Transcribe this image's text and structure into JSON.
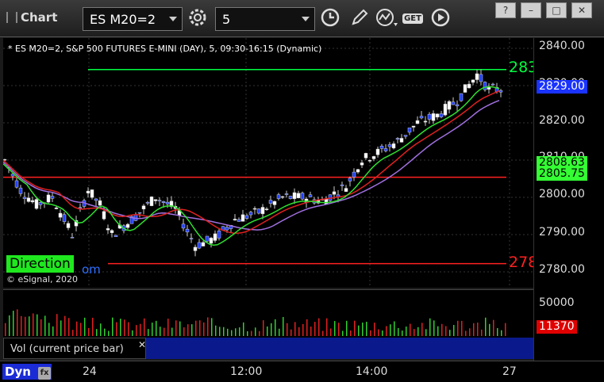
{
  "app": {
    "title": "Chart"
  },
  "toolbar": {
    "symbol": "ES M20=2",
    "interval": "5",
    "icons": [
      "gear-icon",
      "clock-icon",
      "pencil-icon",
      "chart-line-icon",
      "get-icon",
      "play-icon"
    ],
    "get_label": "GET"
  },
  "window_buttons": {
    "help": "?",
    "minimize": "–",
    "restore": "□",
    "close": "✕"
  },
  "chart": {
    "legend": "* ES M20=2, S&P 500 FUTURES E-MINI (DAY), 5, 09:30-16:15 (Dynamic)",
    "copyright": "© eSignal, 2020",
    "direction_label": "Direction",
    "direction_suffix": "om",
    "level_top_label": "283",
    "level_bottom_label": "278"
  },
  "chart_data": {
    "type": "line",
    "price_ticks": [
      "2840.00",
      "2830.00",
      "2820.00",
      "2810.00",
      "2800.00",
      "2790.00",
      "2780.00"
    ],
    "price_tag_last": "2829.00",
    "price_tag_green1": "2808.63",
    "price_tag_green2": "2805.75",
    "vol_ticks": [
      "50000"
    ],
    "vol_tag": "11370",
    "time_ticks": [
      "24",
      "12:00",
      "14:00",
      "27"
    ],
    "levels": [
      2834.3,
      2805.4,
      2782.2
    ]
  },
  "study": {
    "label": "Vol (current price bar)",
    "close": "✕"
  },
  "footer": {
    "dyn": "Dyn",
    "dyn_icon": "fx"
  }
}
